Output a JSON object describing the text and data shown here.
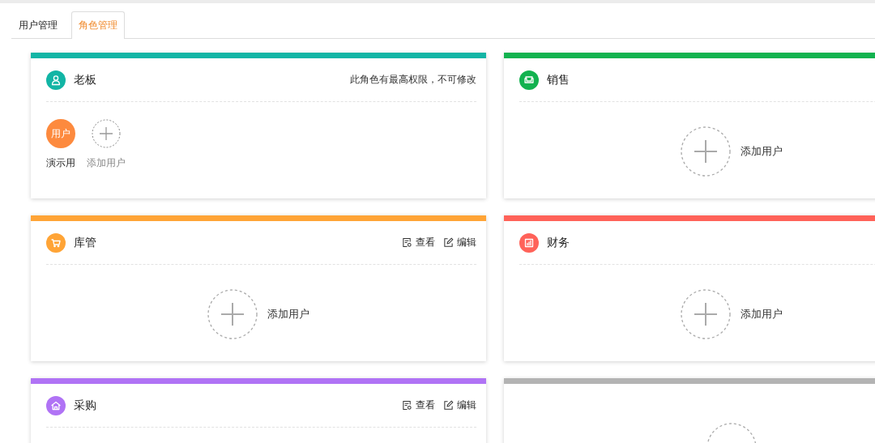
{
  "tabs": [
    {
      "label": "用户管理",
      "selected": false
    },
    {
      "label": "角色管理",
      "selected": true
    }
  ],
  "roles": [
    {
      "kind": "role",
      "name": "老板",
      "color": "#12b5a5",
      "note": "此角色有最高权限，不可修改",
      "users": [
        {
          "avatar": "用户",
          "name": "演示用"
        }
      ],
      "add_label": "添加用户"
    },
    {
      "kind": "role",
      "name": "销售",
      "color": "#12b24f",
      "add_label": "添加用户"
    },
    {
      "kind": "role",
      "name": "库管",
      "color": "#ffa436",
      "actions": [
        "查看",
        "编辑"
      ],
      "add_label": "添加用户"
    },
    {
      "kind": "role",
      "name": "财务",
      "color": "#ff6259",
      "add_label": "添加用户"
    },
    {
      "kind": "role",
      "name": "采购",
      "color": "#b073f5",
      "actions": [
        "查看",
        "编辑"
      ]
    },
    {
      "kind": "new",
      "color": "#b3b3b3"
    }
  ]
}
